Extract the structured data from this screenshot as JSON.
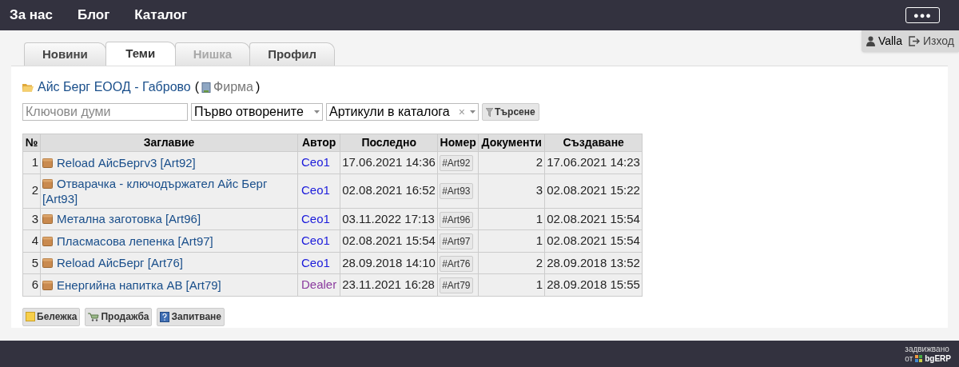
{
  "top_nav": {
    "links": [
      "За нас",
      "Блог",
      "Каталог"
    ],
    "menu_button": "●●●"
  },
  "user_bar": {
    "user": "Valla",
    "logout": "Изход"
  },
  "tabs": [
    {
      "label": "Новини",
      "selected": false,
      "disabled": false
    },
    {
      "label": "Теми",
      "selected": true,
      "disabled": false
    },
    {
      "label": "Нишка",
      "selected": false,
      "disabled": true
    },
    {
      "label": "Профил",
      "selected": false,
      "disabled": false
    }
  ],
  "heading": {
    "folder": "Айс Берг ЕООД - Габрово",
    "open_paren": "(",
    "type": "Фирма",
    "close_paren": ")"
  },
  "filters": {
    "keywords_placeholder": "Ключови думи",
    "order": "Първо отворените",
    "category": "Артикули в каталога",
    "clear": "×",
    "search_button": "Търсене"
  },
  "table": {
    "columns": [
      "№",
      "Заглавие",
      "Автор",
      "Последно",
      "Номер",
      "Документи",
      "Създаване"
    ],
    "rows": [
      {
        "no": "1",
        "title": "Reload АйсБергv3 [Art92]",
        "author": "Ceo1",
        "color": "#1a1adb",
        "last": "17.06.2021 14:36",
        "number": "#Art92",
        "documents": "2",
        "created": "17.06.2021 14:23"
      },
      {
        "no": "2",
        "title": "Отварачка - ключодържател Айс Берг [Art93]",
        "author": "Ceo1",
        "color": "#1a1adb",
        "last": "02.08.2021 16:52",
        "number": "#Art93",
        "documents": "3",
        "created": "02.08.2021 15:22"
      },
      {
        "no": "3",
        "title": "Метална заготовка [Art96]",
        "author": "Ceo1",
        "color": "#1a1adb",
        "last": "03.11.2022 17:13",
        "number": "#Art96",
        "documents": "1",
        "created": "02.08.2021 15:54"
      },
      {
        "no": "4",
        "title": "Пласмасова лепенка [Art97]",
        "author": "Ceo1",
        "color": "#1a1adb",
        "last": "02.08.2021 15:54",
        "number": "#Art97",
        "documents": "1",
        "created": "02.08.2021 15:54"
      },
      {
        "no": "5",
        "title": "Reload АйсБерг [Art76]",
        "author": "Ceo1",
        "color": "#1a1adb",
        "last": "28.09.2018 14:10",
        "number": "#Art76",
        "documents": "2",
        "created": "28.09.2018 13:52"
      },
      {
        "no": "6",
        "title": "Енергийна напитка AB [Art79]",
        "author": "Dealer",
        "color": "#8a3a9e",
        "last": "23.11.2021 16:28",
        "number": "#Art79",
        "documents": "1",
        "created": "28.09.2018 15:55"
      }
    ]
  },
  "actions": [
    {
      "kind": "note",
      "label": "Бележка"
    },
    {
      "kind": "sale",
      "label": "Продажба"
    },
    {
      "kind": "inquiry",
      "label": "Запитване"
    }
  ],
  "footer": {
    "powered": "задвижвано",
    "from": "от",
    "brand": "bgERP"
  }
}
